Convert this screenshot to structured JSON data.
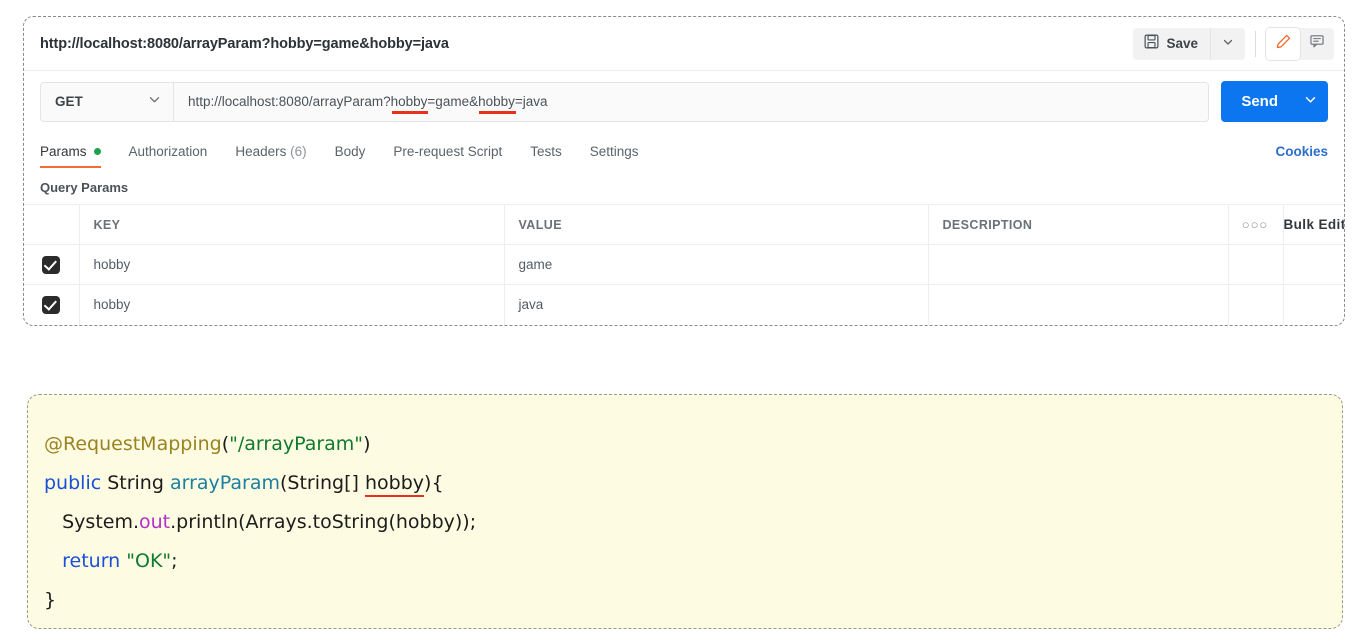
{
  "panel": {
    "title": "http://localhost:8080/arrayParam?hobby=game&hobby=java",
    "save_label": "Save",
    "icons": {
      "save": "floppy-disk-icon",
      "save_caret": "chevron-down-icon",
      "edit": "pencil-icon",
      "comment": "comment-icon"
    }
  },
  "request": {
    "method": "GET",
    "method_caret": "chevron-down-icon",
    "url": "http://localhost:8080/arrayParam?hobby=game&hobby=java",
    "url_prefix_1": "http://localhost:8080/arrayParam?",
    "url_mark_1": "hobby",
    "url_mid": "=game&",
    "url_mark_2": "hobby",
    "url_suffix": "=java",
    "send_label": "Send",
    "send_caret": "chevron-down-icon"
  },
  "tabs": [
    {
      "label": "Params",
      "active": true,
      "dot": true
    },
    {
      "label": "Authorization",
      "active": false
    },
    {
      "label": "Headers",
      "count": "(6)",
      "active": false
    },
    {
      "label": "Body",
      "active": false
    },
    {
      "label": "Pre-request Script",
      "active": false
    },
    {
      "label": "Tests",
      "active": false
    },
    {
      "label": "Settings",
      "active": false
    }
  ],
  "cookies_link": "Cookies",
  "params": {
    "section_label": "Query Params",
    "columns": [
      "KEY",
      "VALUE",
      "DESCRIPTION"
    ],
    "dots_label": "○○○",
    "bulk_edit_label": "Bulk Edit",
    "rows": [
      {
        "checked": true,
        "key": "hobby",
        "value": "game",
        "description": ""
      },
      {
        "checked": true,
        "key": "hobby",
        "value": "java",
        "description": ""
      }
    ]
  },
  "code": {
    "line1": {
      "annotation": "@RequestMapping",
      "open_paren": "(",
      "string": "\"/arrayParam\"",
      "close_paren": ")"
    },
    "line2": {
      "keyword": "public",
      "type": " String ",
      "method": "arrayParam",
      "args_open": "(String[] ",
      "param": "hobby",
      "args_close": "){"
    },
    "line3": {
      "pre": "   System.",
      "field": "out",
      "post": ".println(Arrays.toString(hobby));"
    },
    "line4": {
      "keyword": "   return ",
      "string": "\"OK\"",
      "semi": ";"
    },
    "line5": "}"
  },
  "colors": {
    "send_blue": "#0b76f0",
    "tab_active_orange": "#f26b3a",
    "status_green": "#1aa34a",
    "cookies_blue": "#2c6ecb",
    "underline_red": "#e8301a",
    "code_bg": "#fdfbe2"
  }
}
